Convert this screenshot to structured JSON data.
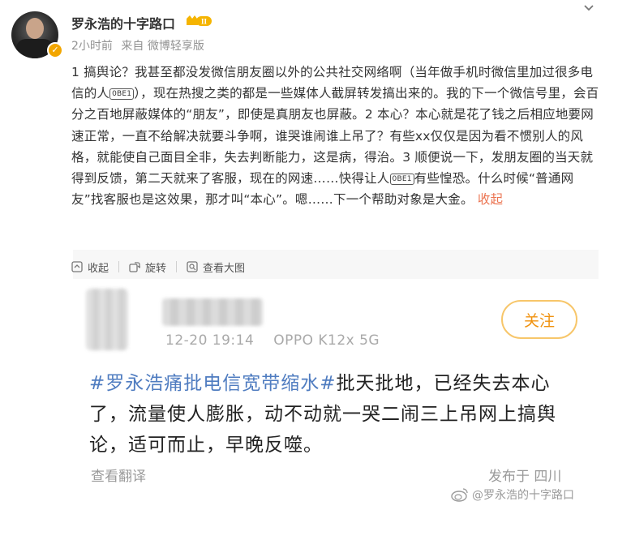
{
  "user": {
    "name": "罗永浩的十字路口",
    "avatar_caption": "罗永浩的十字路口",
    "verified": true,
    "vip_level": "II"
  },
  "meta": {
    "time": "2小时前",
    "source": "来自 微博轻享版"
  },
  "post": {
    "segments": [
      "1 搞舆论？我甚至都没发微信朋友圈以外的公共社交网络啊（当年做手机时微信里加过很多电信的人",
      "），现在热搜之类的都是一些媒体人截屏转发搞出来的。我的下一个微信号里，会百分之百地屏蔽媒体的“朋友”，即使是真朋友也屏蔽。2 本心？本心就是花了钱之后相应地要网速正常，一直不给解决就要斗争啊，谁哭谁闹谁上吊了？有些xx仅仅是因为看不惯别人的风格，就能使自己面目全非，失去判断能力，这是病，得治。3 顺便说一下，发朋友圈的当天就得到反馈，第二天就来了客服，现在的网速……快得让人",
      "有些惶恐。什么时候“普通网友”找客服也是这效果，那才叫“本心”。嗯……下一个帮助对象是大金。"
    ],
    "emoji_code": "0BE1",
    "collapse_label": "收起"
  },
  "toolbar": {
    "collapse": "收起",
    "rotate": "旋转",
    "view_large": "查看大图"
  },
  "repost_image": {
    "time": "12-20 19:14",
    "device": "OPPO K12x 5G",
    "follow_label": "关注",
    "topic": "#罗永浩痛批电信宽带缩水#",
    "body": "批天批地，已经失去本心了，流量使人膨胀，动不动就一哭二闹三上吊网上搞舆论，适可而止，早晚反噬。",
    "translate_label": "查看翻译",
    "location": "发布于 四川"
  },
  "watermark": "@罗永浩的十字路口",
  "colors": {
    "link": "#eb7350",
    "topic": "#4f7cc0",
    "follow_border": "#f7c66a",
    "follow_text": "#f0920f",
    "verify": "#f2a600"
  }
}
